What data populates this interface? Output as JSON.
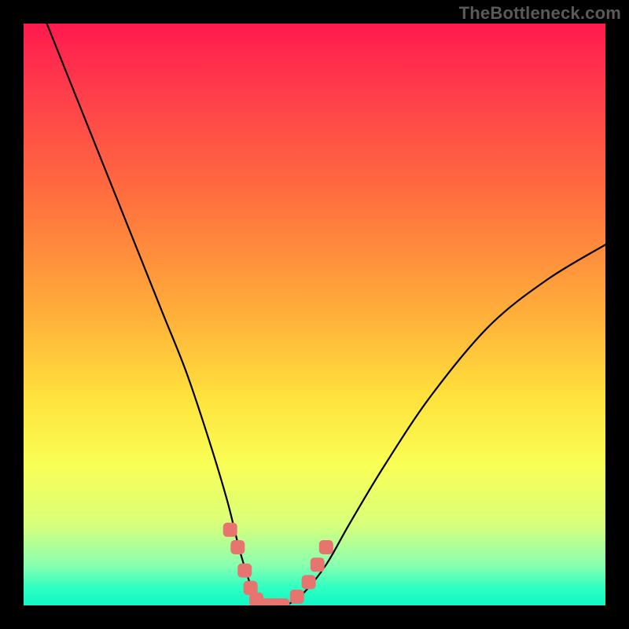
{
  "watermark": "TheBottleneck.com",
  "chart_data": {
    "type": "line",
    "title": "",
    "xlabel": "",
    "ylabel": "",
    "xlim": [
      0,
      100
    ],
    "ylim": [
      0,
      100
    ],
    "legend": false,
    "grid": false,
    "background": "rainbow-gradient (red top to green bottom)",
    "series": [
      {
        "name": "curve",
        "color": "#000",
        "x": [
          4,
          8,
          12,
          16,
          20,
          24,
          28,
          32,
          35,
          37,
          38.5,
          40,
          41.5,
          43,
          45,
          48,
          52,
          56,
          62,
          70,
          80,
          90,
          100
        ],
        "y": [
          100,
          90,
          80,
          70,
          60,
          50,
          40,
          28,
          18,
          10,
          5,
          1,
          0,
          0,
          0,
          2,
          7,
          14,
          24,
          36,
          48,
          56,
          62
        ]
      }
    ],
    "markers": {
      "name": "highlight-points",
      "color": "#e8746f",
      "shape": "rounded-square",
      "points": [
        {
          "x": 35.5,
          "y": 13
        },
        {
          "x": 36.8,
          "y": 10
        },
        {
          "x": 38.0,
          "y": 6
        },
        {
          "x": 39.0,
          "y": 3
        },
        {
          "x": 40.0,
          "y": 1
        },
        {
          "x": 41.5,
          "y": 0
        },
        {
          "x": 43.0,
          "y": 0
        },
        {
          "x": 44.5,
          "y": 0
        },
        {
          "x": 47.0,
          "y": 1.5
        },
        {
          "x": 49.0,
          "y": 4
        },
        {
          "x": 50.5,
          "y": 7
        },
        {
          "x": 52.0,
          "y": 10
        }
      ]
    },
    "note": "Values estimated from pixel positions on 0-100 normalized axes; y=0 at bottom (green), y=100 at top (red)."
  }
}
